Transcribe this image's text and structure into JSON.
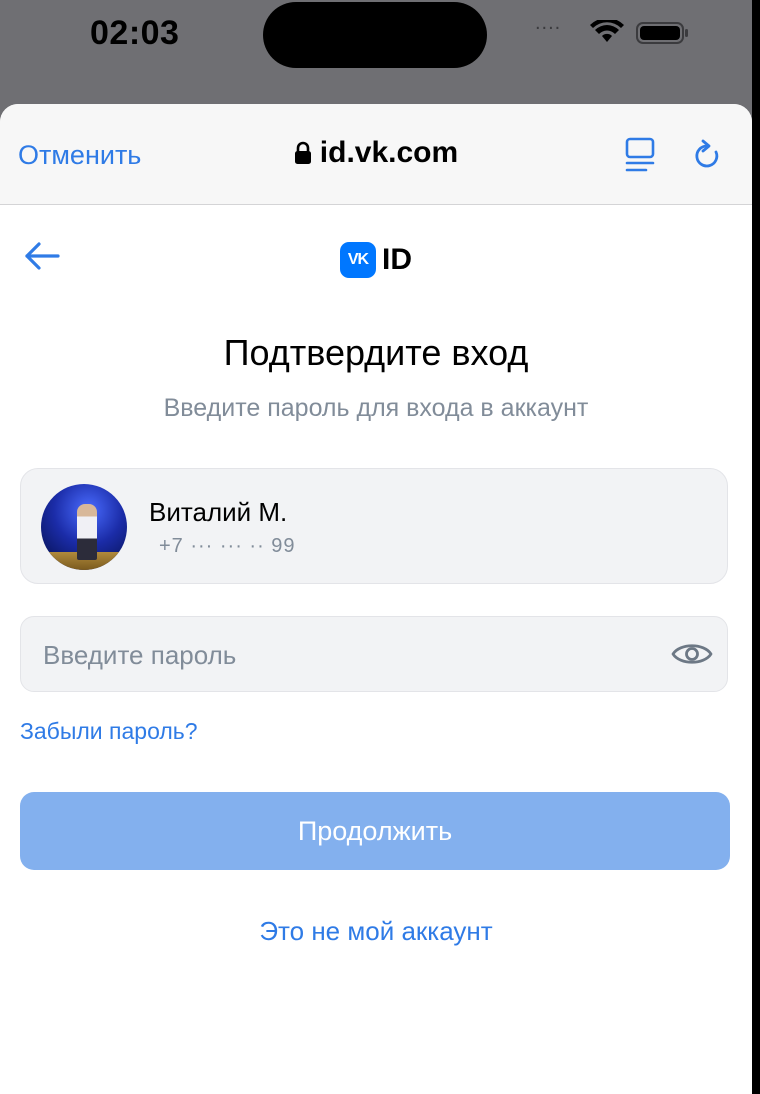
{
  "status_bar": {
    "time": "02:03",
    "dots": "....",
    "icons": [
      "wifi-icon",
      "battery-icon"
    ]
  },
  "browser": {
    "cancel_label": "Отменить",
    "url": "id.vk.com",
    "icons": [
      "lock-icon",
      "reader-icon",
      "reload-icon"
    ]
  },
  "header": {
    "logo_text": "VK",
    "logo_suffix": "ID"
  },
  "main": {
    "title": "Подтвердите вход",
    "subtitle": "Введите пароль для входа в аккаунт",
    "account": {
      "name": "Виталий М.",
      "phone": "+7 ··· ··· ·· 99"
    },
    "password": {
      "placeholder": "Введите пароль",
      "value": ""
    },
    "forgot_label": "Забыли пароль?",
    "continue_label": "Продолжить",
    "not_my_account_label": "Это не мой аккаунт"
  },
  "colors": {
    "accent": "#2f7be6",
    "button_disabled": "#83b0ee",
    "secondary_text": "#818c99",
    "vk_blue": "#0077ff"
  }
}
